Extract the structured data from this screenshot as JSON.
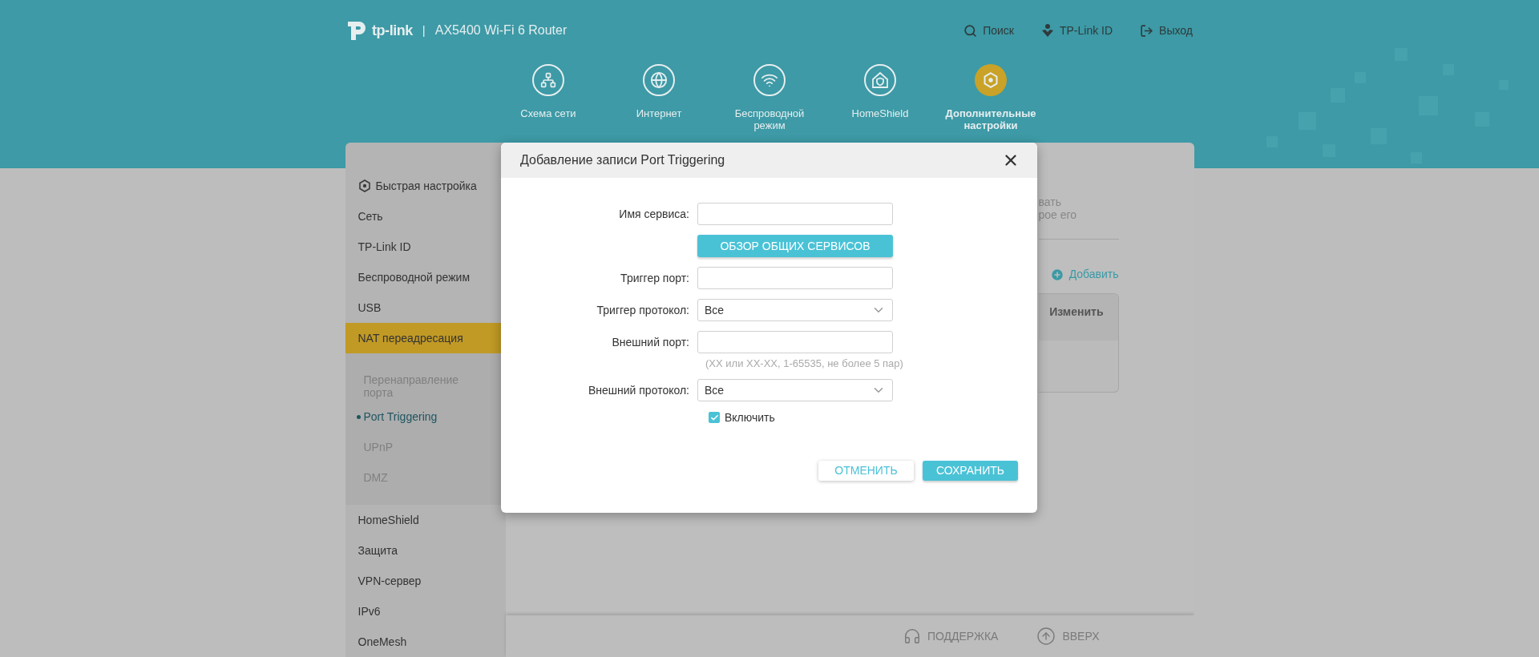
{
  "header": {
    "logo": "tp-link",
    "separator": "|",
    "model": "AX5400 Wi-Fi 6 Router",
    "links": [
      {
        "label": "Поиск"
      },
      {
        "label": "TP-Link ID"
      },
      {
        "label": "Выход"
      }
    ]
  },
  "nav": [
    {
      "label": "Схема сети",
      "selected": false
    },
    {
      "label": "Интернет",
      "selected": false
    },
    {
      "label": "Беспроводной режим",
      "selected": false
    },
    {
      "label": "HomeShield",
      "selected": false
    },
    {
      "label": "Дополнительные настройки",
      "selected": true
    }
  ],
  "sidebar": {
    "items": [
      {
        "label": "Быстрая настройка",
        "selected": false,
        "kind": "icon"
      },
      {
        "label": "Сеть",
        "selected": false
      },
      {
        "label": "TP-Link ID",
        "selected": false
      },
      {
        "label": "Беспроводной режим",
        "selected": false
      },
      {
        "label": "USB",
        "selected": false
      },
      {
        "label": "NAT переадресация",
        "selected": true,
        "children": [
          {
            "label": "Перенаправление порта",
            "selected": false
          },
          {
            "label": "Port Triggering",
            "selected": true
          },
          {
            "label": "UPnP",
            "selected": false
          },
          {
            "label": "DMZ",
            "selected": false
          }
        ]
      },
      {
        "label": "HomeShield",
        "selected": false
      },
      {
        "label": "Защита",
        "selected": false
      },
      {
        "label": "VPN-сервер",
        "selected": false
      },
      {
        "label": "IPv6",
        "selected": false
      },
      {
        "label": "OneMesh",
        "selected": false
      }
    ]
  },
  "content": {
    "description_fragments": [
      "вать",
      "рое его"
    ],
    "add_link": "Добавить",
    "table": {
      "columns": [
        "Изменить"
      ]
    }
  },
  "footer": {
    "links": [
      {
        "label": "ПОДДЕРЖКА"
      },
      {
        "label": "ВВЕРХ"
      }
    ]
  },
  "dialog": {
    "title": "Добавление записи Port Triggering",
    "fields": [
      {
        "kind": "text",
        "label": "Имя сервиса:"
      },
      {
        "kind": "button",
        "label": "ОБЗОР ОБЩИХ СЕРВИСОВ"
      },
      {
        "kind": "text",
        "label": "Триггер порт:"
      },
      {
        "kind": "select",
        "label": "Триггер протокол:",
        "value": "Все"
      },
      {
        "kind": "text",
        "label": "Внешний порт:"
      },
      {
        "kind": "hint",
        "text": "(XX или XX-XX, 1-65535, не более 5 пар)"
      },
      {
        "kind": "select",
        "label": "Внешний протокол:",
        "value": "Все"
      },
      {
        "kind": "checkbox",
        "label": "Включить",
        "checked": true
      }
    ],
    "buttons": [
      {
        "kind": "secondary",
        "label": "ОТМЕНИТЬ"
      },
      {
        "kind": "primary",
        "label": "СОХРАНИТЬ"
      }
    ]
  }
}
